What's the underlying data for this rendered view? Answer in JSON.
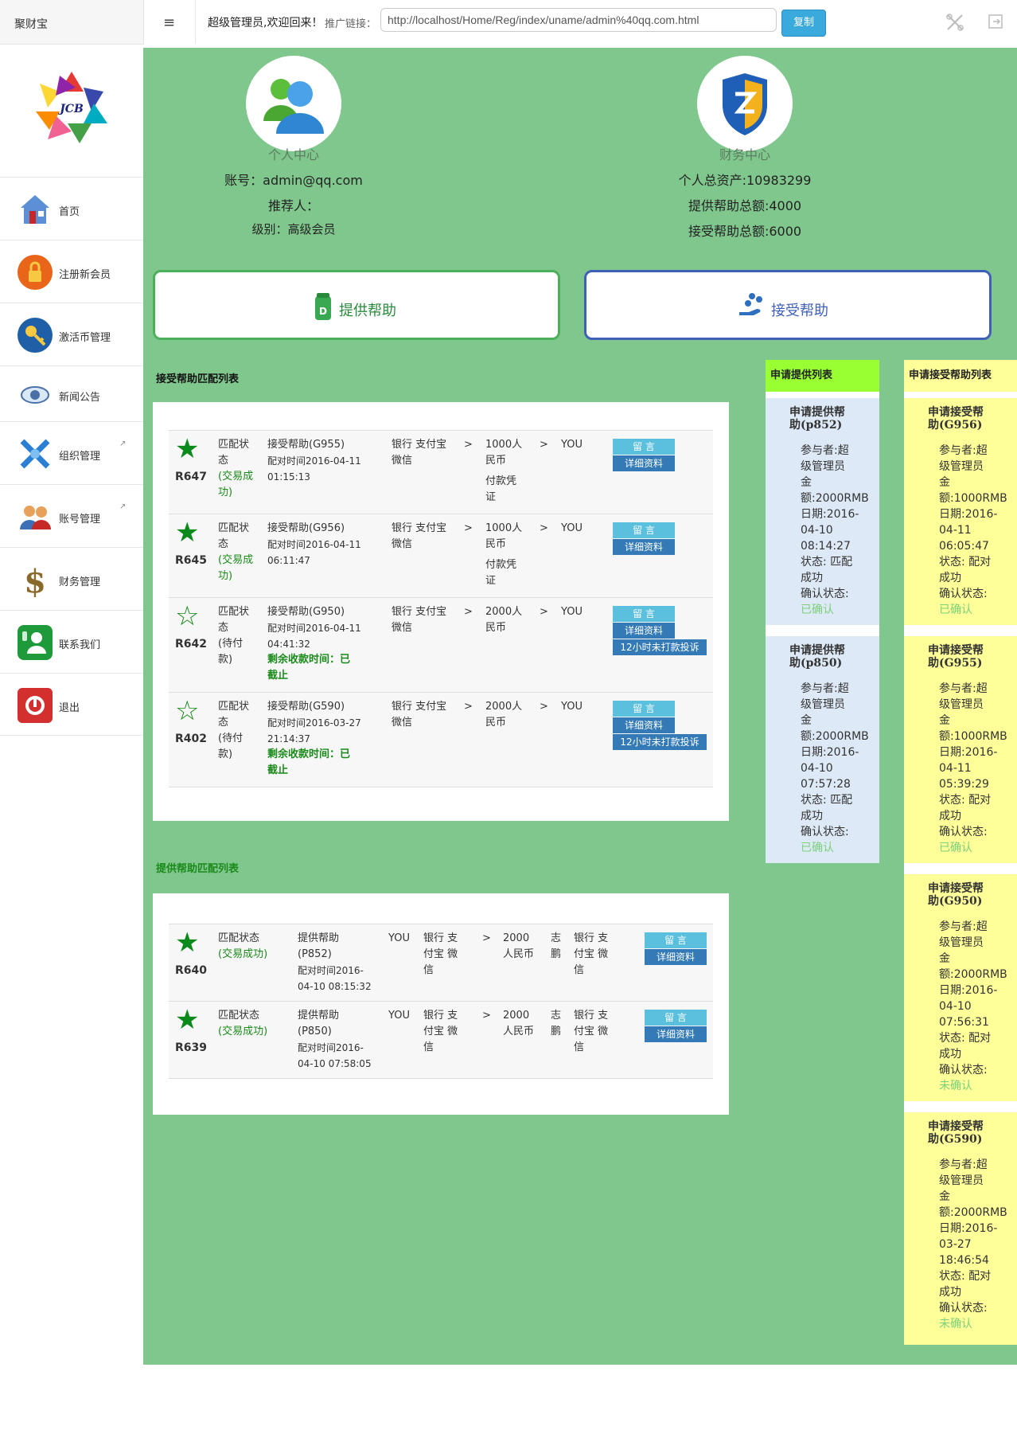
{
  "topbar": {
    "brand": "聚财宝",
    "menu_icon": "≡",
    "welcome": "超级管理员,欢迎回来！",
    "promo_label": "推广链接：",
    "promo_url": "http://localhost/Home/Reg/index/uname/admin%40qq.com.html",
    "copy_label": "复制"
  },
  "sidebar": {
    "items": [
      {
        "label": "首页",
        "icon": "home-icon"
      },
      {
        "label": "注册新会员",
        "icon": "lock-icon"
      },
      {
        "label": "激活币管理",
        "icon": "key-icon"
      },
      {
        "label": "新闻公告",
        "icon": "eye-icon"
      },
      {
        "label": "组织管理",
        "icon": "network-icon"
      },
      {
        "label": "账号管理",
        "icon": "users-icon"
      },
      {
        "label": "财务管理",
        "icon": "dollar-icon"
      },
      {
        "label": "联系我们",
        "icon": "contact-icon"
      },
      {
        "label": "退出",
        "icon": "power-icon"
      }
    ]
  },
  "personal": {
    "title": "个人中心",
    "account": "账号：admin@qq.com",
    "referrer": "推荐人：",
    "level": "级别：高级会员"
  },
  "finance": {
    "title": "财务中心",
    "total_assets": "个人总资产:10983299",
    "provide_total": "提供帮助总额:4000",
    "receive_total": "接受帮助总额:6000"
  },
  "actions": {
    "provide": "提供帮助",
    "receive": "接受帮助"
  },
  "receive_list": {
    "title": "接受帮助匹配列表",
    "rows": [
      {
        "id": "R647",
        "status": [
          "匹配状",
          "态",
          "(交易成",
          "功)"
        ],
        "type": "接受帮助(G955)",
        "time": [
          "配对时间2016-04-11",
          "01:15:13"
        ],
        "pay": "银行 支付宝",
        "pay2": "微信",
        "amount": [
          "1000人",
          "民币"
        ],
        "proof": [
          "付款凭",
          "证"
        ],
        "target": "YOU",
        "msg": "留 言",
        "detail": "详细资料",
        "remain": [],
        "complain": "",
        "solid": true
      },
      {
        "id": "R645",
        "status": [
          "匹配状",
          "态",
          "(交易成",
          "功)"
        ],
        "type": "接受帮助(G956)",
        "time": [
          "配对时间2016-04-11",
          "06:11:47"
        ],
        "pay": "银行 支付宝",
        "pay2": "微信",
        "amount": [
          "1000人",
          "民币"
        ],
        "proof": [
          "付款凭",
          "证"
        ],
        "target": "YOU",
        "msg": "留 言",
        "detail": "详细资料",
        "remain": [],
        "complain": "",
        "solid": true
      },
      {
        "id": "R642",
        "status": [
          "匹配状",
          "态",
          "(待付",
          "款)"
        ],
        "type": "接受帮助(G950)",
        "time": [
          "配对时间2016-04-11",
          "04:41:32"
        ],
        "pay": "银行 支付宝",
        "pay2": "微信",
        "amount": [
          "2000人",
          "民币"
        ],
        "proof": [],
        "target": "YOU",
        "msg": "留 言",
        "detail": "详细资料",
        "remain": [
          "剩余收款时间：已",
          "截止"
        ],
        "complain": "12小时未打款投诉",
        "solid": false
      },
      {
        "id": "R402",
        "status": [
          "匹配状",
          "态",
          "(待付",
          "款)"
        ],
        "type": "接受帮助(G590)",
        "time": [
          "配对时间2016-03-27",
          "21:14:37"
        ],
        "pay": "银行 支付宝",
        "pay2": "微信",
        "amount": [
          "2000人",
          "民币"
        ],
        "proof": [],
        "target": "YOU",
        "msg": "留 言",
        "detail": "详细资料",
        "remain": [
          "剩余收款时间：已",
          "截止"
        ],
        "complain": "12小时未打款投诉",
        "solid": false
      }
    ]
  },
  "provide_list": {
    "title": "提供帮助匹配列表",
    "rows": [
      {
        "id": "R640",
        "status": [
          "匹配状态",
          "(交易成功)"
        ],
        "type": [
          "提供帮助",
          "(P852)"
        ],
        "time": [
          "配对时间2016-",
          "04-10 08:15:32"
        ],
        "you": "YOU",
        "pay": [
          "银行 支",
          "付宝 微",
          "信"
        ],
        "amount": [
          "2000",
          "人民币"
        ],
        "person": [
          "志",
          "鹏"
        ],
        "pay2": [
          "银行 支",
          "付宝 微",
          "信"
        ],
        "msg": "留 言",
        "detail": "详细资料"
      },
      {
        "id": "R639",
        "status": [
          "匹配状态",
          "(交易成功)"
        ],
        "type": [
          "提供帮助",
          "(P850)"
        ],
        "time": [
          "配对时间2016-",
          "04-10 07:58:05"
        ],
        "you": "YOU",
        "pay": [
          "银行 支",
          "付宝 微",
          "信"
        ],
        "amount": [
          "2000",
          "人民币"
        ],
        "person": [
          "志",
          "鹏"
        ],
        "pay2": [
          "银行 支",
          "付宝 微",
          "信"
        ],
        "msg": "留 言",
        "detail": "详细资料"
      }
    ]
  },
  "apply_provide": {
    "title": "申请提供列表",
    "cards": [
      {
        "title": [
          "申请提供帮",
          "助(p852)"
        ],
        "lines": [
          "参与者:超",
          "级管理员",
          "金",
          "额:2000RMB",
          "日期:2016-",
          "04-10",
          "08:14:27",
          "状态: 匹配",
          "成功",
          "确认状态:"
        ],
        "confirm": "已确认"
      },
      {
        "title": [
          "申请提供帮",
          "助(p850)"
        ],
        "lines": [
          "参与者:超",
          "级管理员",
          "金",
          "额:2000RMB",
          "日期:2016-",
          "04-10",
          "07:57:28",
          "状态: 匹配",
          "成功",
          "确认状态:"
        ],
        "confirm": "已确认"
      }
    ]
  },
  "apply_receive": {
    "title": "申请接受帮助列表",
    "cards": [
      {
        "title": [
          "申请接受帮",
          "助(G956)"
        ],
        "lines": [
          "参与者:超",
          "级管理员",
          "金",
          "额:1000RMB",
          "日期:2016-",
          "04-11",
          "06:05:47",
          "状态: 配对",
          "成功",
          "确认状态:"
        ],
        "confirm": "已确认"
      },
      {
        "title": [
          "申请接受帮",
          "助(G955)"
        ],
        "lines": [
          "参与者:超",
          "级管理员",
          "金",
          "额:1000RMB",
          "日期:2016-",
          "04-11",
          "05:39:29",
          "状态: 配对",
          "成功",
          "确认状态:"
        ],
        "confirm": "已确认"
      },
      {
        "title": [
          "申请接受帮",
          "助(G950)"
        ],
        "lines": [
          "参与者:超",
          "级管理员",
          "金",
          "额:2000RMB",
          "日期:2016-",
          "04-10",
          "07:56:31",
          "状态: 配对",
          "成功",
          "确认状态:"
        ],
        "confirm": "未确认"
      },
      {
        "title": [
          "申请接受帮",
          "助(G590)"
        ],
        "lines": [
          "参与者:超",
          "级管理员",
          "金",
          "额:2000RMB",
          "日期:2016-",
          "03-27",
          "18:46:54",
          "状态: 配对",
          "成功",
          "确认状态:"
        ],
        "confirm": "未确认"
      }
    ]
  },
  "colors": {
    "main_bg": "#80c78d",
    "provide_col": "#dde9f6",
    "receive_col": "#ffff99",
    "apply_provide_head": "#99ff33",
    "star": "#0a8a1a"
  }
}
